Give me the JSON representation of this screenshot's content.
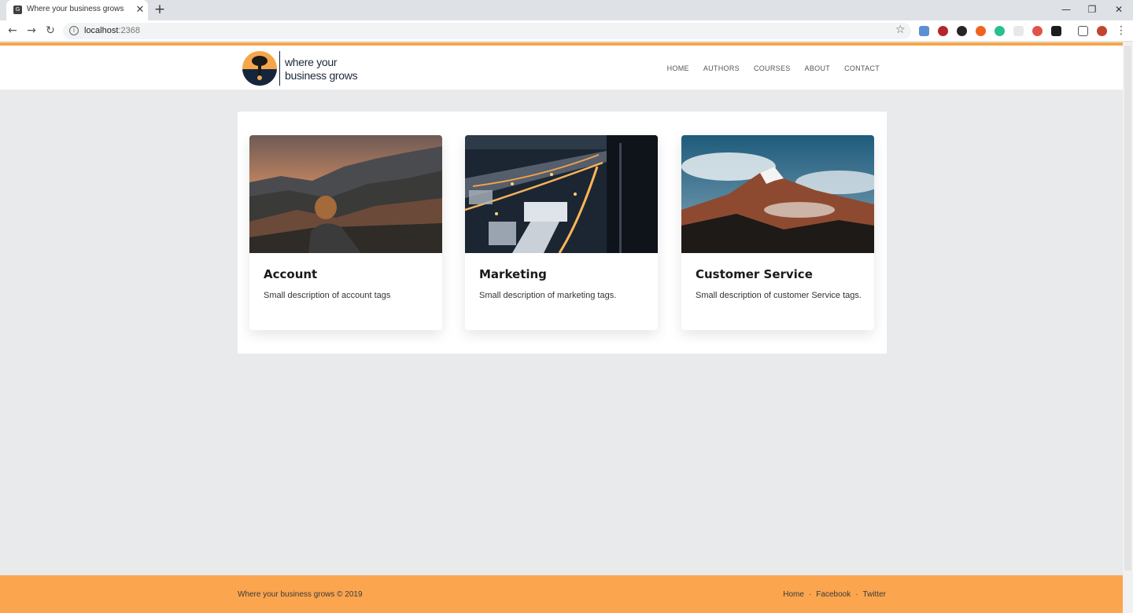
{
  "browser": {
    "tab_title": "Where your business grows",
    "tab_close": "✕",
    "new_tab": "+",
    "url_host": "localhost",
    "url_port": ":2368",
    "window_controls": {
      "minimize": "—",
      "restore": "❐",
      "close": "✕"
    },
    "extension_colors": [
      "#5a8fd6",
      "#b3262c",
      "#262626",
      "#f0631e",
      "#27c08e",
      "#e8e8e8",
      "#e0534a",
      "#1c1c1c",
      "#555555",
      "#c0472f"
    ]
  },
  "site": {
    "logo_line1": "where your",
    "logo_line2": "business grows",
    "nav": [
      "HOME",
      "AUTHORS",
      "COURSES",
      "ABOUT",
      "CONTACT"
    ],
    "accent_color": "#f7a64b"
  },
  "cards": [
    {
      "title": "Account",
      "description": "Small description of account tags",
      "image": "person-on-mountain-sunset-photo"
    },
    {
      "title": "Marketing",
      "description": "Small description of marketing tags.",
      "image": "city-night-aerial-photo"
    },
    {
      "title": "Customer Service",
      "description": "Small description of customer Service tags.",
      "image": "snowy-mountain-peak-photo"
    }
  ],
  "footer": {
    "copyright": "Where your business grows © 2019",
    "links": [
      "Home",
      "Facebook",
      "Twitter"
    ],
    "separator": "·"
  }
}
